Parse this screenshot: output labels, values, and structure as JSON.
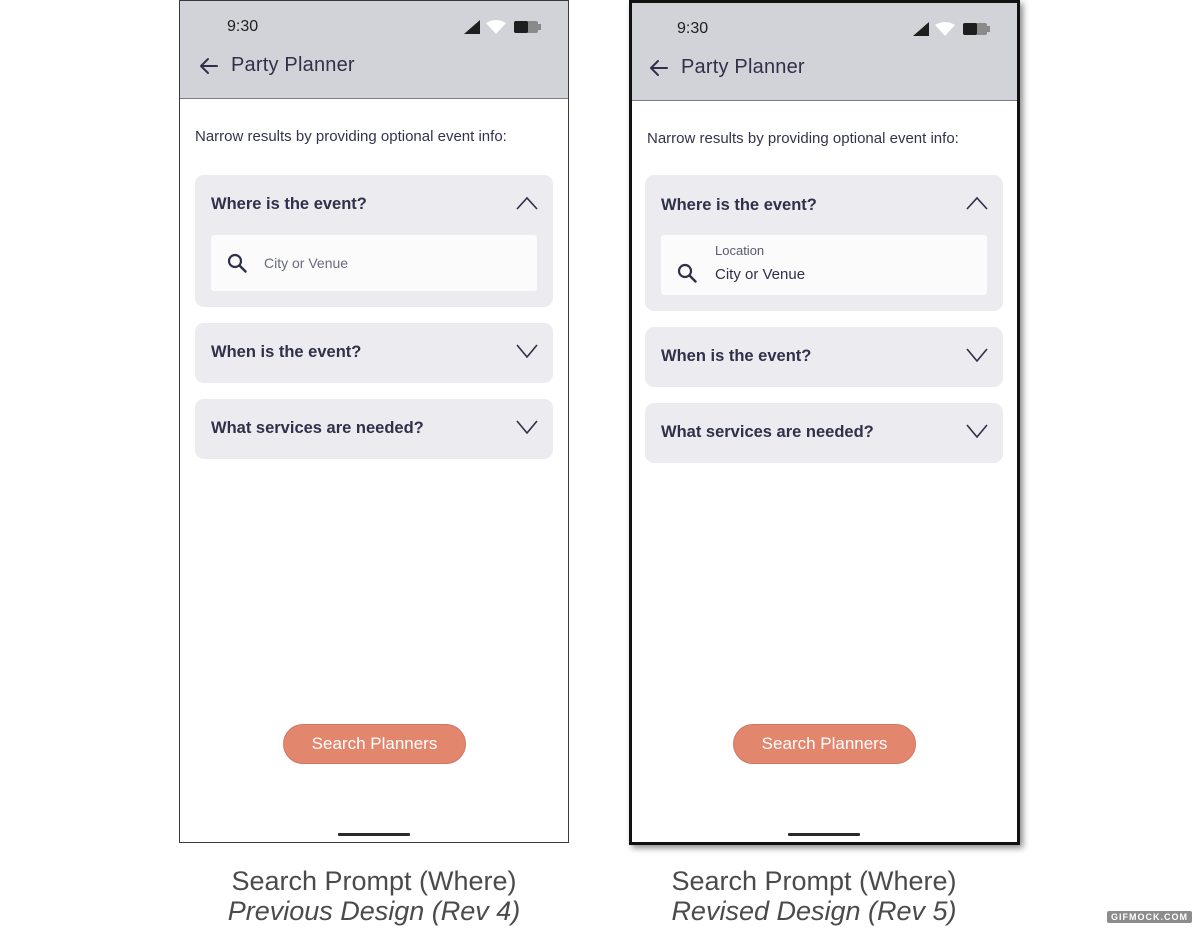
{
  "status": {
    "time": "9:30"
  },
  "header": {
    "title": "Party Planner"
  },
  "intro": "Narrow results by providing optional event info:",
  "questions": {
    "where": "Where is the event?",
    "when": "When is the event?",
    "services": "What services are needed?"
  },
  "previous": {
    "search_placeholder": "City or Venue",
    "caption_title": "Search Prompt (Where)",
    "caption_subtitle": "Previous Design (Rev 4)"
  },
  "revised": {
    "field_label": "Location",
    "field_value": "City or Venue",
    "caption_title": "Search Prompt (Where)",
    "caption_subtitle": "Revised Design (Rev 5)"
  },
  "button": {
    "label": "Search Planners"
  },
  "watermark": "GIFMOCK.COM",
  "icons": {
    "back": "arrow-left-icon",
    "signal": "cell-signal-icon",
    "wifi": "wifi-icon",
    "battery": "battery-icon",
    "expanded": "chevron-up-icon",
    "collapsed": "chevron-down-icon",
    "search": "magnifier-icon"
  },
  "colors": {
    "appbar": "#d2d3d9",
    "card": "#ebebf0",
    "accent": "#e3866e",
    "text": "#2f3049"
  }
}
